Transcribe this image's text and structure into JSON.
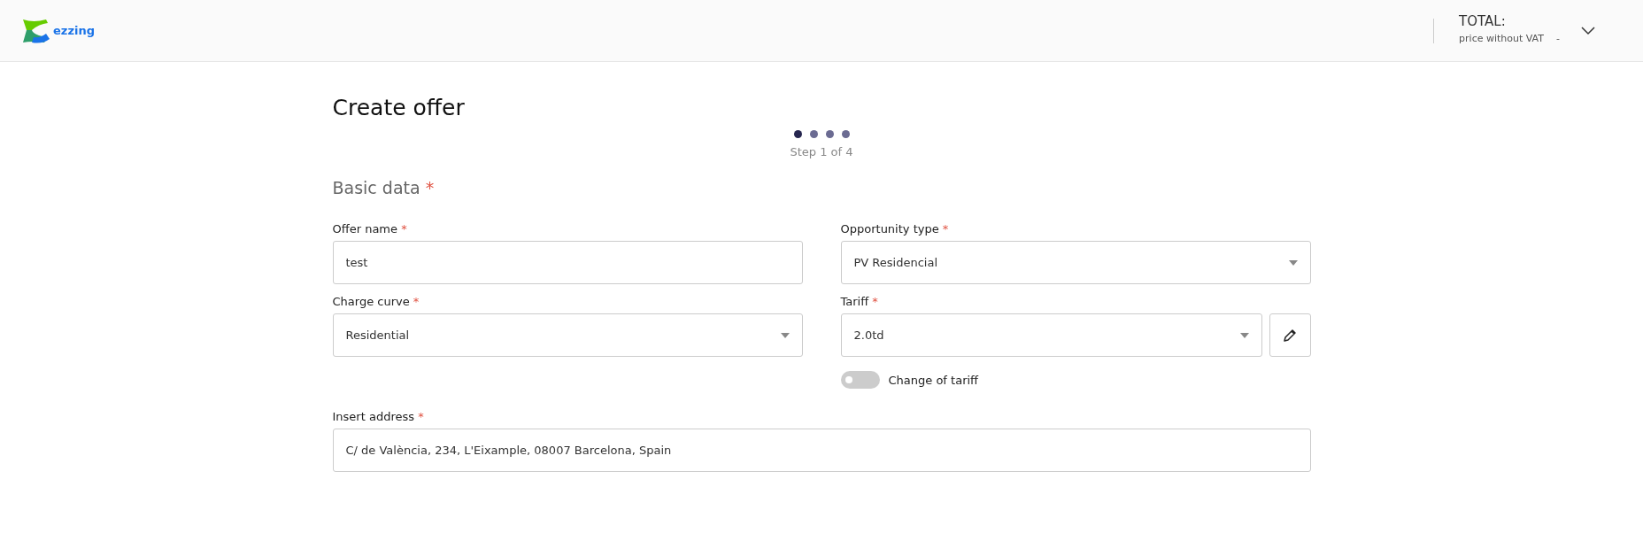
{
  "header": {
    "logo_text": "ezzing",
    "total_label": "TOTAL:",
    "price_label": "price without VAT",
    "price_value": "-"
  },
  "page": {
    "title": "Create offer",
    "steps": [
      {
        "selected": true
      },
      {
        "selected": false
      },
      {
        "selected": false
      },
      {
        "selected": false
      }
    ],
    "step_text": "Step 1 of 4",
    "section": {
      "title": "Basic data",
      "required_mark": "*"
    },
    "fields": [
      {
        "kind": "text",
        "label": "Offer name",
        "required_mark": "*",
        "value": "test"
      },
      {
        "kind": "select",
        "label": "Opportunity type",
        "required_mark": "*",
        "value": "PV Residencial"
      },
      {
        "kind": "select",
        "label": "Charge curve",
        "required_mark": "*",
        "value": "Residential"
      },
      {
        "kind": "select_edit",
        "label": "Tariff",
        "required_mark": "*",
        "value": "2.0td",
        "toggle": {
          "label": "Change of tariff",
          "on": false
        }
      },
      {
        "kind": "wide_text",
        "label": "Insert address",
        "required_mark": "*",
        "value": "C/ de València, 234, L'Eixample, 08007 Barcelona, Spain"
      }
    ]
  }
}
